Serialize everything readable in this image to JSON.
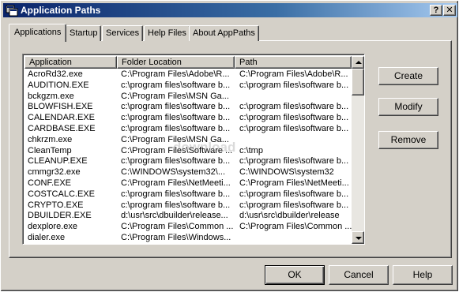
{
  "window": {
    "title": "Application Paths",
    "help_glyph": "?",
    "close_glyph": "✕"
  },
  "tabs": [
    "Applications",
    "Startup",
    "Services",
    "Help Files",
    "About AppPaths"
  ],
  "list": {
    "columns": [
      "Application",
      "Folder Location",
      "Path"
    ],
    "rows": [
      [
        "AcroRd32.exe",
        "C:\\Program Files\\Adobe\\R...",
        "C:\\Program Files\\Adobe\\R..."
      ],
      [
        "AUDITION.EXE",
        "c:\\program files\\software b...",
        "c:\\program files\\software b..."
      ],
      [
        "bckgzm.exe",
        "C:\\Program Files\\MSN Ga...",
        ""
      ],
      [
        "BLOWFISH.EXE",
        "c:\\program files\\software b...",
        "c:\\program files\\software b..."
      ],
      [
        "CALENDAR.EXE",
        "c:\\program files\\software b...",
        "c:\\program files\\software b..."
      ],
      [
        "CARDBASE.EXE",
        "c:\\program files\\software b...",
        "c:\\program files\\software b..."
      ],
      [
        "chkrzm.exe",
        "C:\\Program Files\\MSN Ga...",
        ""
      ],
      [
        "CleanTemp",
        "C:\\Program Files\\Software ...",
        "c:\\tmp"
      ],
      [
        "CLEANUP.EXE",
        "c:\\program files\\software b...",
        "c:\\program files\\software b..."
      ],
      [
        "cmmgr32.exe",
        "C:\\WINDOWS\\system32\\...",
        "C:\\WINDOWS\\system32"
      ],
      [
        "CONF.EXE",
        "C:\\Program Files\\NetMeeti...",
        "C:\\Program Files\\NetMeeti..."
      ],
      [
        "COSTCALC.EXE",
        "c:\\program files\\software b...",
        "c:\\program files\\software b..."
      ],
      [
        "CRYPTO.EXE",
        "c:\\program files\\software b...",
        "c:\\program files\\software b..."
      ],
      [
        "DBUILDER.EXE",
        "d:\\usr\\src\\dbuilder\\release...",
        "d:\\usr\\src\\dbuilder\\release"
      ],
      [
        "dexplore.exe",
        "C:\\Program Files\\Common ...",
        "C:\\Program Files\\Common ..."
      ],
      [
        "dialer.exe",
        "C:\\Program Files\\Windows...",
        ""
      ]
    ]
  },
  "buttons": {
    "create": "Create",
    "modify": "Modify",
    "remove": "Remove",
    "ok": "OK",
    "cancel": "Cancel",
    "help": "Help"
  },
  "watermark": "download"
}
